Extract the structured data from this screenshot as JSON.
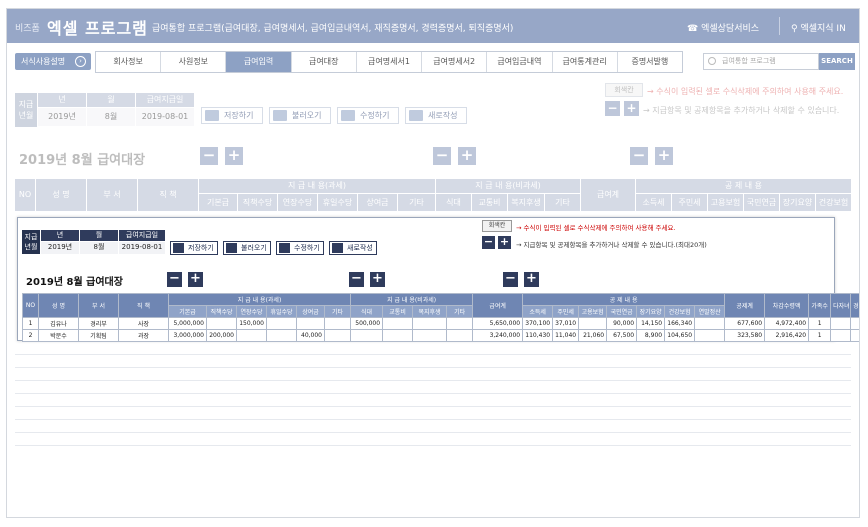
{
  "header": {
    "brand_small": "비즈폼",
    "brand": "엑셀 프로그램",
    "subtitle": "급여통합 프로그램(급여대장, 급여명세서, 급여입금내역서, 재직증명서, 경력증명서, 퇴직증명서)",
    "consult": "엑셀상담서비스",
    "knowledge": "엑셀지식 IN"
  },
  "nav": {
    "guide": "서식사용설명",
    "tabs": [
      {
        "label": "회사정보"
      },
      {
        "label": "사원정보"
      },
      {
        "label": "급여입력"
      },
      {
        "label": "급여대장"
      },
      {
        "label": "급여명세서1"
      },
      {
        "label": "급여명세서2"
      },
      {
        "label": "급여입금내역"
      },
      {
        "label": "급여통계관리"
      },
      {
        "label": "증명서발행"
      }
    ],
    "search_placeholder": "급여통합 프로그램",
    "search_button": "SEARCH"
  },
  "background": {
    "date_label": "지급\n년월",
    "year_header": "년",
    "month_header": "월",
    "pay_date_header": "급여지급일",
    "year": "2019년",
    "month": "8월",
    "pay_date": "2019-08-01",
    "buttons": {
      "save": "저장하기",
      "load": "불러오기",
      "edit": "수정하기",
      "new": "새로작성"
    },
    "legend_box": "회색칸",
    "note1": "→ 수식이 입력된 셀로 수식삭제에 주의하여 사용해 주세요.",
    "note2": "→ 지급항목 및 공제항목을 추가하거나 삭제할 수 있습니다.",
    "title": "2019년 8월 급여대장",
    "group_taxable": "지 급 내 용(과세)",
    "group_nontax": "지 급 내 용(비과세)",
    "group_total": "급여계",
    "group_deduct": "공 제 내 용",
    "cols_left": [
      "NO",
      "성 명",
      "부 서",
      "직 책"
    ],
    "cols_taxable": [
      "기본급",
      "직책수당",
      "연장수당",
      "휴일수당",
      "상여금",
      "기타"
    ],
    "cols_nontax": [
      "식대",
      "교통비",
      "복지후생",
      "기타"
    ],
    "cols_deduct": [
      "소득세",
      "주민세",
      "고용보험",
      "국민연금",
      "장기요양",
      "건강보험"
    ]
  },
  "popup": {
    "date_label": "지급\n년월",
    "year_header": "년",
    "month_header": "월",
    "pay_date_header": "급여지급일",
    "year": "2019년",
    "month": "8월",
    "pay_date": "2019-08-01",
    "buttons": {
      "save": "저장하기",
      "load": "불러오기",
      "edit": "수정하기",
      "new": "새로작성"
    },
    "legend_box": "회색칸",
    "note1": "→ 수식이 입력된 셀로 수식삭제에 주의하여 사용해 주세요.",
    "note2": "→ 지급항목 및 공제항목을 추가하거나 삭제할 수 있습니다.(최대20개)",
    "title": "2019년 8월 급여대장",
    "table": {
      "group_taxable": "지 급 내 용(과세)",
      "group_nontax": "지 급 내 용(비과세)",
      "group_total": "급여계",
      "group_deduct": "공 제 내 용",
      "group_deduct_total": "공제계",
      "group_net": "차감수령액",
      "group_family": "가족수",
      "group_child": "다자녀",
      "group_cert": "경감대상",
      "cols_left": [
        "NO",
        "성 명",
        "부 서",
        "직 책"
      ],
      "cols_taxable": [
        "기본급",
        "직책수당",
        "연장수당",
        "휴일수당",
        "상여금",
        "기타"
      ],
      "cols_nontax": [
        "식대",
        "교통비",
        "복지후생",
        "기타"
      ],
      "cols_deduct": [
        "소득세",
        "주민세",
        "고용보험",
        "국민연금",
        "장기요양",
        "건강보험",
        "연말정산"
      ],
      "rows": [
        {
          "no": "1",
          "name": "김유나",
          "dept": "경리부",
          "title": "사장",
          "taxable": [
            "5,000,000",
            "",
            "150,000",
            "",
            "",
            ""
          ],
          "nontax": [
            "500,000",
            "",
            "",
            ""
          ],
          "total": "5,650,000",
          "deduct": [
            "370,100",
            "37,010",
            "",
            "90,000",
            "14,150",
            "166,340",
            ""
          ],
          "deduct_total": "677,600",
          "net": "4,972,400",
          "family": "1",
          "child": "",
          "cert": ""
        },
        {
          "no": "2",
          "name": "박문수",
          "dept": "기획팀",
          "title": "과장",
          "taxable": [
            "3,000,000",
            "200,000",
            "",
            "",
            "40,000",
            ""
          ],
          "nontax": [
            "",
            "",
            "",
            ""
          ],
          "total": "3,240,000",
          "deduct": [
            "110,430",
            "11,040",
            "21,060",
            "67,500",
            "8,900",
            "104,650",
            ""
          ],
          "deduct_total": "323,580",
          "net": "2,916,420",
          "family": "1",
          "child": "",
          "cert": ""
        }
      ]
    }
  },
  "icons": {
    "phone": "phone-icon",
    "pin": "location-pin-icon",
    "search": "search-icon",
    "save": "save-icon",
    "load": "load-icon",
    "edit": "edit-icon",
    "new": "new-icon"
  },
  "colors": {
    "header_bg": "#97a7c7",
    "accent": "#8da1c4",
    "popup_dark": "#2f3b5c",
    "note_red": "#c00000"
  }
}
